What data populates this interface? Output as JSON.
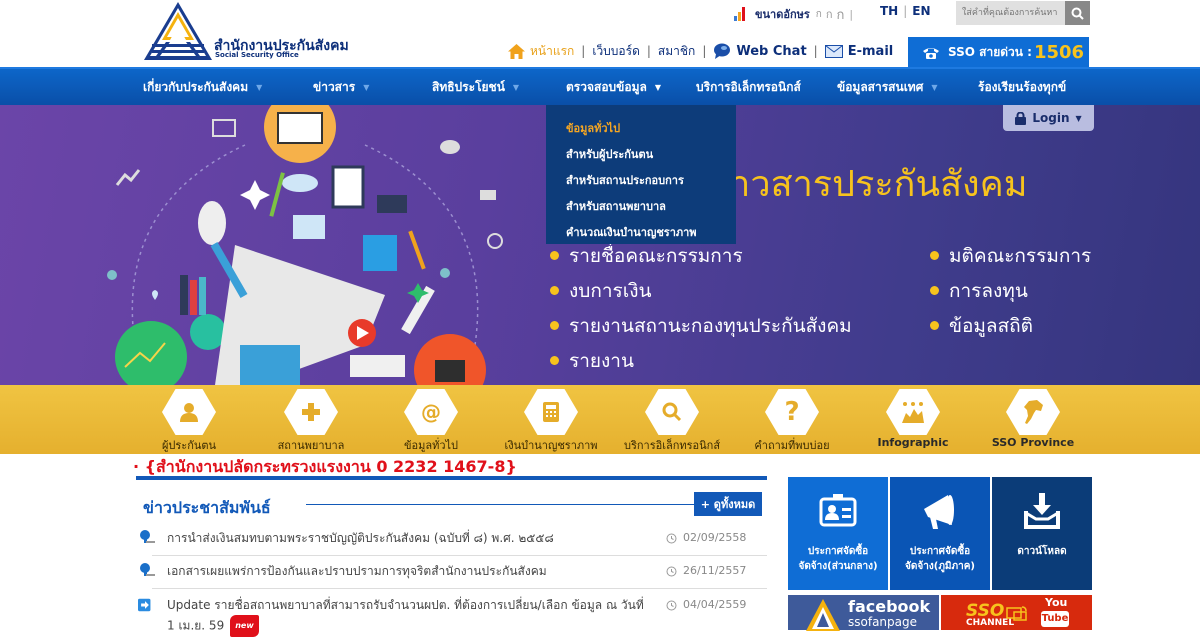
{
  "header": {
    "logo_th": "สำนักงานประกันสังคม",
    "logo_en": "Social Security Office",
    "font_size_label": "ขนาดอักษร",
    "font_sizes": [
      "ก",
      "ก",
      "ก"
    ],
    "languages": [
      "TH",
      "EN"
    ],
    "search_placeholder": "ใส่คำที่คุณต้องการค้นหา",
    "top_links": [
      {
        "label": "หน้าแรก",
        "icon": "home-icon"
      },
      {
        "label": "เว็บบอร์ด"
      },
      {
        "label": "สมาชิก"
      },
      {
        "label": "Web Chat",
        "icon": "chat-bubble-icon"
      },
      {
        "label": "E-mail",
        "icon": "envelope-icon"
      }
    ],
    "hotline_label": "SSO สายด่วน :",
    "hotline_number": "1506"
  },
  "nav": {
    "items": [
      {
        "label": "เกี่ยวกับประกันสังคม",
        "has_caret": true
      },
      {
        "label": "ข่าวสาร",
        "has_caret": true
      },
      {
        "label": "สิทธิประโยชน์",
        "has_caret": true
      },
      {
        "label": "ตรวจสอบข้อมูล",
        "has_caret": true,
        "active": true
      },
      {
        "label": "บริการอิเล็กทรอนิกส์",
        "has_caret": false
      },
      {
        "label": "ข้อมูลสารสนเทศ",
        "has_caret": true
      },
      {
        "label": "ร้องเรียนร้องทุกข์",
        "has_caret": false
      }
    ],
    "dropdown": [
      {
        "label": "ข้อมูลทั่วไป",
        "active": true
      },
      {
        "label": "สำหรับผู้ประกันตน"
      },
      {
        "label": "สำหรับสถานประกอบการ"
      },
      {
        "label": "สำหรับสถานพยาบาล"
      },
      {
        "label": "คำนวณเงินบำนาญชราภาพ"
      }
    ]
  },
  "hero": {
    "login_label": "Login",
    "heading": "ศูนย์ข้อมูลข่าวสารประกันสังคม",
    "left_list": [
      "รายชื่อคณะกรรมการ",
      "งบการเงิน",
      "รายงานสถานะกองทุนประกันสังคม",
      "รายงาน"
    ],
    "right_list": [
      "มติคณะกรรมการ",
      "การลงทุน",
      "ข้อมูลสถิติ"
    ]
  },
  "quick_links": [
    {
      "label": "ผู้ประกันตน",
      "icon": "person-icon",
      "glyph": "👤"
    },
    {
      "label": "สถานพยาบาล",
      "icon": "medical-cross-icon",
      "glyph": "✚"
    },
    {
      "label": "ข้อมูลทั่วไป",
      "icon": "at-sign-icon",
      "glyph": "@"
    },
    {
      "label": "เงินบำนาญชราภาพ",
      "icon": "calculator-icon",
      "glyph": "▦"
    },
    {
      "label": "บริการอิเล็กทรอนิกส์",
      "icon": "search-icon",
      "glyph": "⚲"
    },
    {
      "label": "คำถามที่พบบ่อย",
      "icon": "question-mark-icon",
      "glyph": "?"
    },
    {
      "label": "Infographic",
      "icon": "infographic-icon",
      "glyph": "▟"
    },
    {
      "label": "SSO Province",
      "icon": "thailand-map-icon",
      "glyph": "⬳"
    }
  ],
  "marquee": "· {สำนักงานปลัดกระทรวงแรงงาน 0 2232 1467-8}",
  "news": {
    "title": "ข่าวประชาสัมพันธ์",
    "more_label": "+ ดูทั้งหมด",
    "items": [
      {
        "text": "การนำส่งเงินสมทบตามพระราชบัญญัติประกันสังคม (ฉบับที่ ๘) พ.ศ. ๒๕๕๘",
        "date": "02/09/2558",
        "icon": "pushpin-icon"
      },
      {
        "text": "เอกสารเผยแพร่การป้องกันและปราบปรามการทุจริตสำนักงานประกันสังคม",
        "date": "26/11/2557",
        "icon": "pushpin-icon"
      },
      {
        "text": "Update รายชื่อสถานพยาบาลที่สามารถรับจำนวนผปต. ที่ต้องการเปลี่ยน/เลือก ข้อมูล ณ วันที่ 1 เม.ย. 59",
        "date": "04/04/2559",
        "icon": "arrow-right-icon",
        "badge": "new"
      }
    ]
  },
  "tiles": [
    {
      "line1": "ประกาศจัดซื้อ",
      "line2": "จัดจ้าง(ส่วนกลาง)",
      "icon": "id-card-icon",
      "color": "#0f6dd5"
    },
    {
      "line1": "ประกาศจัดซื้อ",
      "line2": "จัดจ้าง(ภูมิภาค)",
      "icon": "megaphone-icon",
      "color": "#0a55b5"
    },
    {
      "line1": "ดาวน์โหลด",
      "line2": "",
      "icon": "download-icon",
      "color": "#0b3c78"
    }
  ],
  "banners": {
    "facebook_title": "facebook",
    "facebook_sub": "ssofanpage",
    "youtube_sso": "SSO",
    "youtube_channel": "CHANNEL",
    "youtube_you": "You",
    "youtube_tube": "Tube"
  },
  "colors": {
    "brand_blue": "#0f6dd5",
    "nav_blue": "#0a4fa8",
    "accent_yellow": "#f7c31d",
    "alert_red": "#e0101a",
    "dropdown_bg": "#0d3c7a",
    "hero_purple": "#5a3f9e"
  }
}
